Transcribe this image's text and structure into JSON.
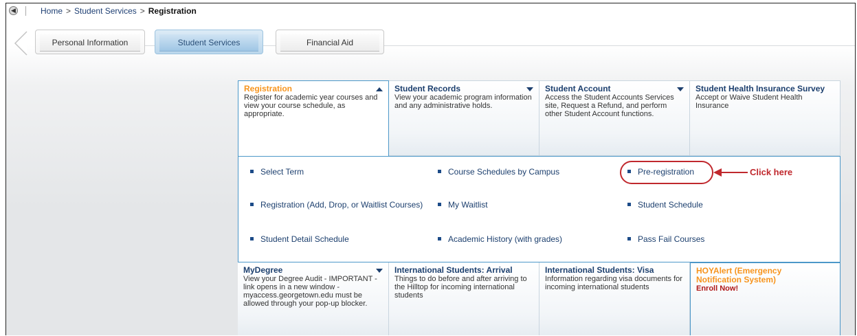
{
  "breadcrumb": {
    "home": "Home",
    "sep": ">",
    "student_services": "Student Services",
    "current": "Registration"
  },
  "tabs": [
    {
      "label": "Personal Information",
      "active": false
    },
    {
      "label": "Student Services",
      "active": true
    },
    {
      "label": "Financial Aid",
      "active": false
    }
  ],
  "panels_top": [
    {
      "title": "Registration",
      "desc": "Register for academic year courses and view your course schedule, as appropriate.",
      "expanded": true
    },
    {
      "title": "Student Records",
      "desc": "View your academic program information and any administrative holds."
    },
    {
      "title": "Student Account",
      "desc": "Access the Student Accounts Services site, Request a Refund, and perform other Student Account functions."
    },
    {
      "title": "Student Health Insurance Survey",
      "desc": "Accept or Waive Student Health Insurance"
    }
  ],
  "registration_links": [
    [
      "Select Term",
      "Course Schedules by Campus",
      "Pre-registration"
    ],
    [
      "Registration (Add, Drop, or Waitlist Courses)",
      "My Waitlist",
      "Student Schedule"
    ],
    [
      "Student Detail Schedule",
      "Academic History (with grades)",
      "Pass Fail Courses"
    ]
  ],
  "annotation": {
    "text": "Click here",
    "color": "#c0282d"
  },
  "panels_bottom": [
    {
      "title": "MyDegree",
      "desc": "View your Degree Audit - IMPORTANT - link opens in a new window - myaccess.georgetown.edu must be allowed through your pop-up blocker."
    },
    {
      "title": "International Students: Arrival",
      "desc": "Things to do before and after arriving to the Hilltop for incoming international students"
    },
    {
      "title": "International Students: Visa",
      "desc": "Information regarding visa documents for incoming international students"
    },
    {
      "title": "HOYAlert (Emergency Notification System)",
      "desc": "Enroll Now!"
    }
  ],
  "colors": {
    "title_blue": "#1c3f6e",
    "orange": "#f7941d",
    "border_blue": "#4c97c8"
  }
}
